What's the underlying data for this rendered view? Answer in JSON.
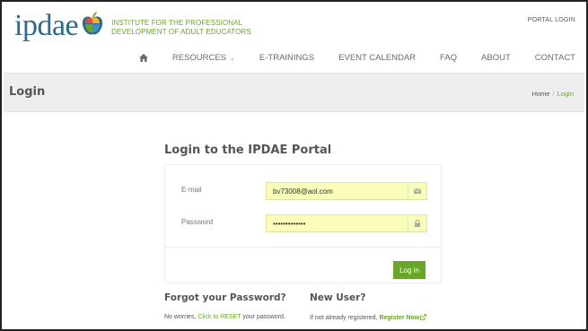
{
  "header": {
    "logo_text": "ipdae",
    "tagline_line1": "INSTITUTE FOR THE PROFESSIONAL",
    "tagline_line2": "DEVELOPMENT OF ADULT EDUCATORS",
    "portal_login": "PORTAL LOGIN"
  },
  "nav": {
    "home_icon": "home-icon",
    "items": [
      {
        "label": "RESOURCES",
        "dropdown": true
      },
      {
        "label": "E-TRAININGS"
      },
      {
        "label": "EVENT CALENDAR"
      },
      {
        "label": "FAQ"
      },
      {
        "label": "ABOUT"
      },
      {
        "label": "CONTACT"
      }
    ],
    "dropdown_glyph": "⌄"
  },
  "title_bar": {
    "title": "Login",
    "breadcrumb": {
      "home": "Home",
      "separator": "/",
      "current": "Login"
    }
  },
  "login": {
    "heading": "Login to the IPDAE Portal",
    "email_label": "E-mail",
    "email_value": "bv73008@aol.com",
    "email_icon": "envelope-icon",
    "password_label": "Password",
    "password_value": "•••••••••••••",
    "password_icon": "lock-icon",
    "submit_label": "Log in"
  },
  "forgot": {
    "heading": "Forgot your Password?",
    "text_before": "No worries, ",
    "link": "Click to RESET",
    "text_after": " your password."
  },
  "new_user": {
    "heading": "New User?",
    "text_before": "If not already registered, ",
    "link": "Register Now",
    "link_icon": "external-link-icon"
  },
  "colors": {
    "brand_blue": "#2f6a8c",
    "brand_green": "#6aa629",
    "field_fill": "#fafdb9",
    "title_bar_bg": "#eeeeee"
  }
}
